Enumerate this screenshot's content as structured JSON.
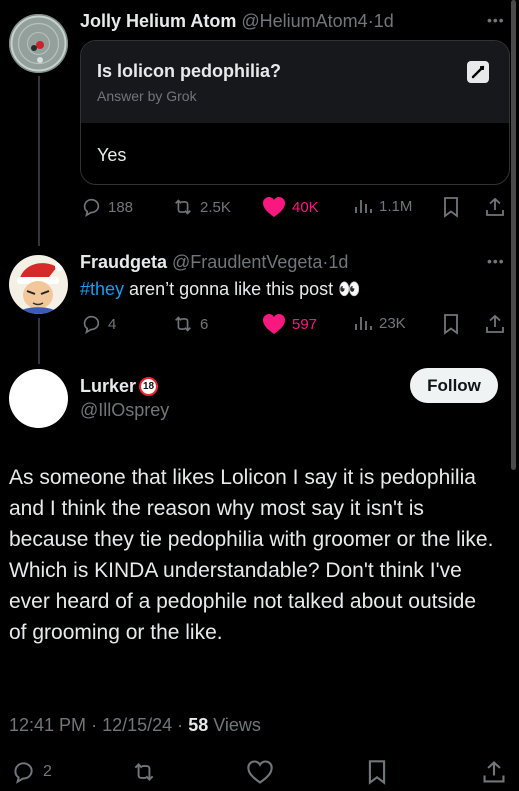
{
  "tweet1": {
    "display_name": "Jolly Helium Atom",
    "handle": "@HeliumAtom4",
    "sep": "·",
    "age": "1d",
    "grok_card": {
      "question": "Is lolicon pedophilia?",
      "subtitle": "Answer by Grok",
      "answer": "Yes"
    },
    "stats": {
      "replies": "188",
      "reposts": "2.5K",
      "likes": "40K",
      "views": "1.1M"
    }
  },
  "tweet2": {
    "display_name": "Fraudgeta",
    "handle": "@FraudlentVegeta",
    "sep": "·",
    "age": "1d",
    "hashtag": "#they",
    "body": " aren’t gonna like this post ",
    "emoji": "👀",
    "stats": {
      "replies": "4",
      "reposts": "6",
      "likes": "597",
      "views": "23K"
    }
  },
  "main_tweet": {
    "display_name": "Lurker",
    "badge": "18",
    "handle": "@IllOsprey",
    "follow_label": "Follow",
    "text": "As someone that likes Lolicon I say it is pedophilia and I think the reason why most say it isn't is because they tie pedophilia with groomer or the like.\nWhich is KINDA understandable? Don't think I've ever heard of a pedophile not talked about outside of grooming or the like.",
    "time": "12:41 PM",
    "date": "12/15/24",
    "views_count": "58",
    "views_label": "Views",
    "sep": "·",
    "replies": "2"
  },
  "colors": {
    "accent": "#1d9bf0",
    "like": "#f91880",
    "muted": "#71767b",
    "text": "#e7e9ea"
  }
}
